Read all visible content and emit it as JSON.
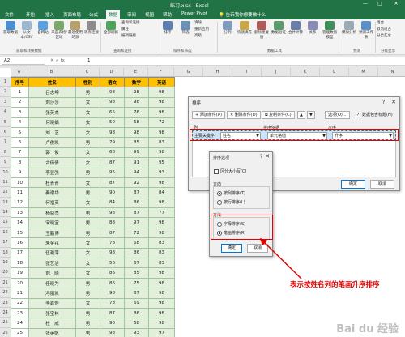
{
  "window": {
    "title": "练习.xlsx - Excel",
    "minimize": "—",
    "maximize": "□",
    "close": "✕"
  },
  "menu": {
    "tabs": [
      "文件",
      "开始",
      "插入",
      "页面布局",
      "公式",
      "数据",
      "审阅",
      "视图",
      "帮助",
      "Power Pivot"
    ],
    "active_tab": "数据",
    "tell_me": "告诉我你想要做什么"
  },
  "ribbon": {
    "buttons": [
      "获取数据",
      "从文本/CSV",
      "自网站",
      "来自表格/区域",
      "最近使用的源",
      "现有连接",
      "全部刷新",
      "查询和连接",
      "属性",
      "编辑链接",
      "排序",
      "筛选",
      "清除",
      "重新应用",
      "高级",
      "分列",
      "快速填充",
      "删除重复值",
      "数据验证",
      "合并计算",
      "关系",
      "管理数据模型",
      "模拟分析",
      "预测工作表",
      "组合",
      "取消组合",
      "分类汇总"
    ],
    "groups": [
      "获取和转换数据",
      "查询和连接",
      "排序和筛选",
      "数据工具",
      "预测",
      "分级显示"
    ]
  },
  "formula_bar": {
    "name_box": "A2",
    "cell_value": "1"
  },
  "columns": [
    "A",
    "B",
    "C",
    "D",
    "E",
    "F",
    "G",
    "H",
    "I",
    "J",
    "K",
    "L",
    "M",
    "N"
  ],
  "rows": [
    "1",
    "2",
    "3",
    "4",
    "5",
    "6",
    "7",
    "8",
    "9",
    "10",
    "11",
    "12",
    "13",
    "14",
    "15",
    "16",
    "17",
    "18",
    "19",
    "20",
    "21",
    "22",
    "23",
    "24",
    "25",
    "26"
  ],
  "table": {
    "headers": [
      "序号",
      "姓名",
      "性别",
      "语文",
      "数学",
      "英语"
    ],
    "rows": [
      [
        "1",
        "吕志坤",
        "男",
        "98",
        "98",
        "98"
      ],
      [
        "2",
        "刘莎莎",
        "女",
        "98",
        "98",
        "98"
      ],
      [
        "3",
        "张英杰",
        "女",
        "65",
        "76",
        "98"
      ],
      [
        "4",
        "何晓娟",
        "女",
        "50",
        "68",
        "72"
      ],
      [
        "5",
        "刘　艺",
        "女",
        "98",
        "98",
        "98"
      ],
      [
        "6",
        "卢俊凯",
        "男",
        "79",
        "85",
        "83"
      ],
      [
        "7",
        "郭　俊",
        "女",
        "68",
        "99",
        "98"
      ],
      [
        "8",
        "古倩倩",
        "女",
        "87",
        "91",
        "95"
      ],
      [
        "9",
        "李显强",
        "男",
        "95",
        "94",
        "93"
      ],
      [
        "10",
        "杜青青",
        "女",
        "87",
        "92",
        "98"
      ],
      [
        "11",
        "秦谢华",
        "男",
        "90",
        "87",
        "84"
      ],
      [
        "12",
        "何福英",
        "女",
        "84",
        "86",
        "98"
      ],
      [
        "13",
        "杨益杰",
        "男",
        "98",
        "87",
        "77"
      ],
      [
        "14",
        "宋晓宝",
        "男",
        "88",
        "97",
        "98"
      ],
      [
        "15",
        "王鹏博",
        "男",
        "87",
        "72",
        "98"
      ],
      [
        "16",
        "朱金花",
        "女",
        "78",
        "68",
        "83"
      ],
      [
        "17",
        "伍艳萍",
        "女",
        "98",
        "86",
        "83"
      ],
      [
        "18",
        "张艺洁",
        "女",
        "56",
        "67",
        "83"
      ],
      [
        "19",
        "刘　晓",
        "女",
        "86",
        "85",
        "98"
      ],
      [
        "20",
        "任晓为",
        "男",
        "86",
        "75",
        "98"
      ],
      [
        "21",
        "冯丽凯",
        "男",
        "98",
        "87",
        "98"
      ],
      [
        "22",
        "李鑫怡",
        "女",
        "78",
        "69",
        "98"
      ],
      [
        "23",
        "张宝林",
        "男",
        "87",
        "86",
        "98"
      ],
      [
        "24",
        "杜　威",
        "男",
        "90",
        "68",
        "98"
      ],
      [
        "25",
        "张英帆",
        "男",
        "98",
        "93",
        "97"
      ]
    ]
  },
  "sort_dialog": {
    "title": "排序",
    "help": "?",
    "close": "✕",
    "add_level": "添加条件(A)",
    "delete_level": "删除条件(D)",
    "copy_level": "复制条件(C)",
    "options": "选项(O)...",
    "has_headers": "数据包含标题(H)",
    "col_header": "列",
    "sort_on_header": "排序依据",
    "order_header": "次序",
    "primary_key_label": "主要关键字",
    "primary_key_value": "姓名",
    "sort_on_value": "单元格值",
    "order_value": "升序",
    "ok": "确定",
    "cancel": "取消"
  },
  "options_dialog": {
    "title": "排序选项",
    "help": "?",
    "close": "✕",
    "case_sensitive": "区分大小写(C)",
    "direction_label": "方向",
    "dir_rows": "按列排序(T)",
    "dir_cols": "按行排序(L)",
    "method_label": "方法",
    "method_alpha": "字母排序(S)",
    "method_stroke": "笔画排序(R)",
    "ok": "确定",
    "cancel": "取消"
  },
  "annotation": "表示按姓名列的笔画升序排序",
  "watermark": "Bai du 经验",
  "colors": {
    "excel_green": "#217346",
    "header_fill": "#ffc000",
    "body_fill": "#e2efda",
    "annotation_red": "#e00000"
  }
}
